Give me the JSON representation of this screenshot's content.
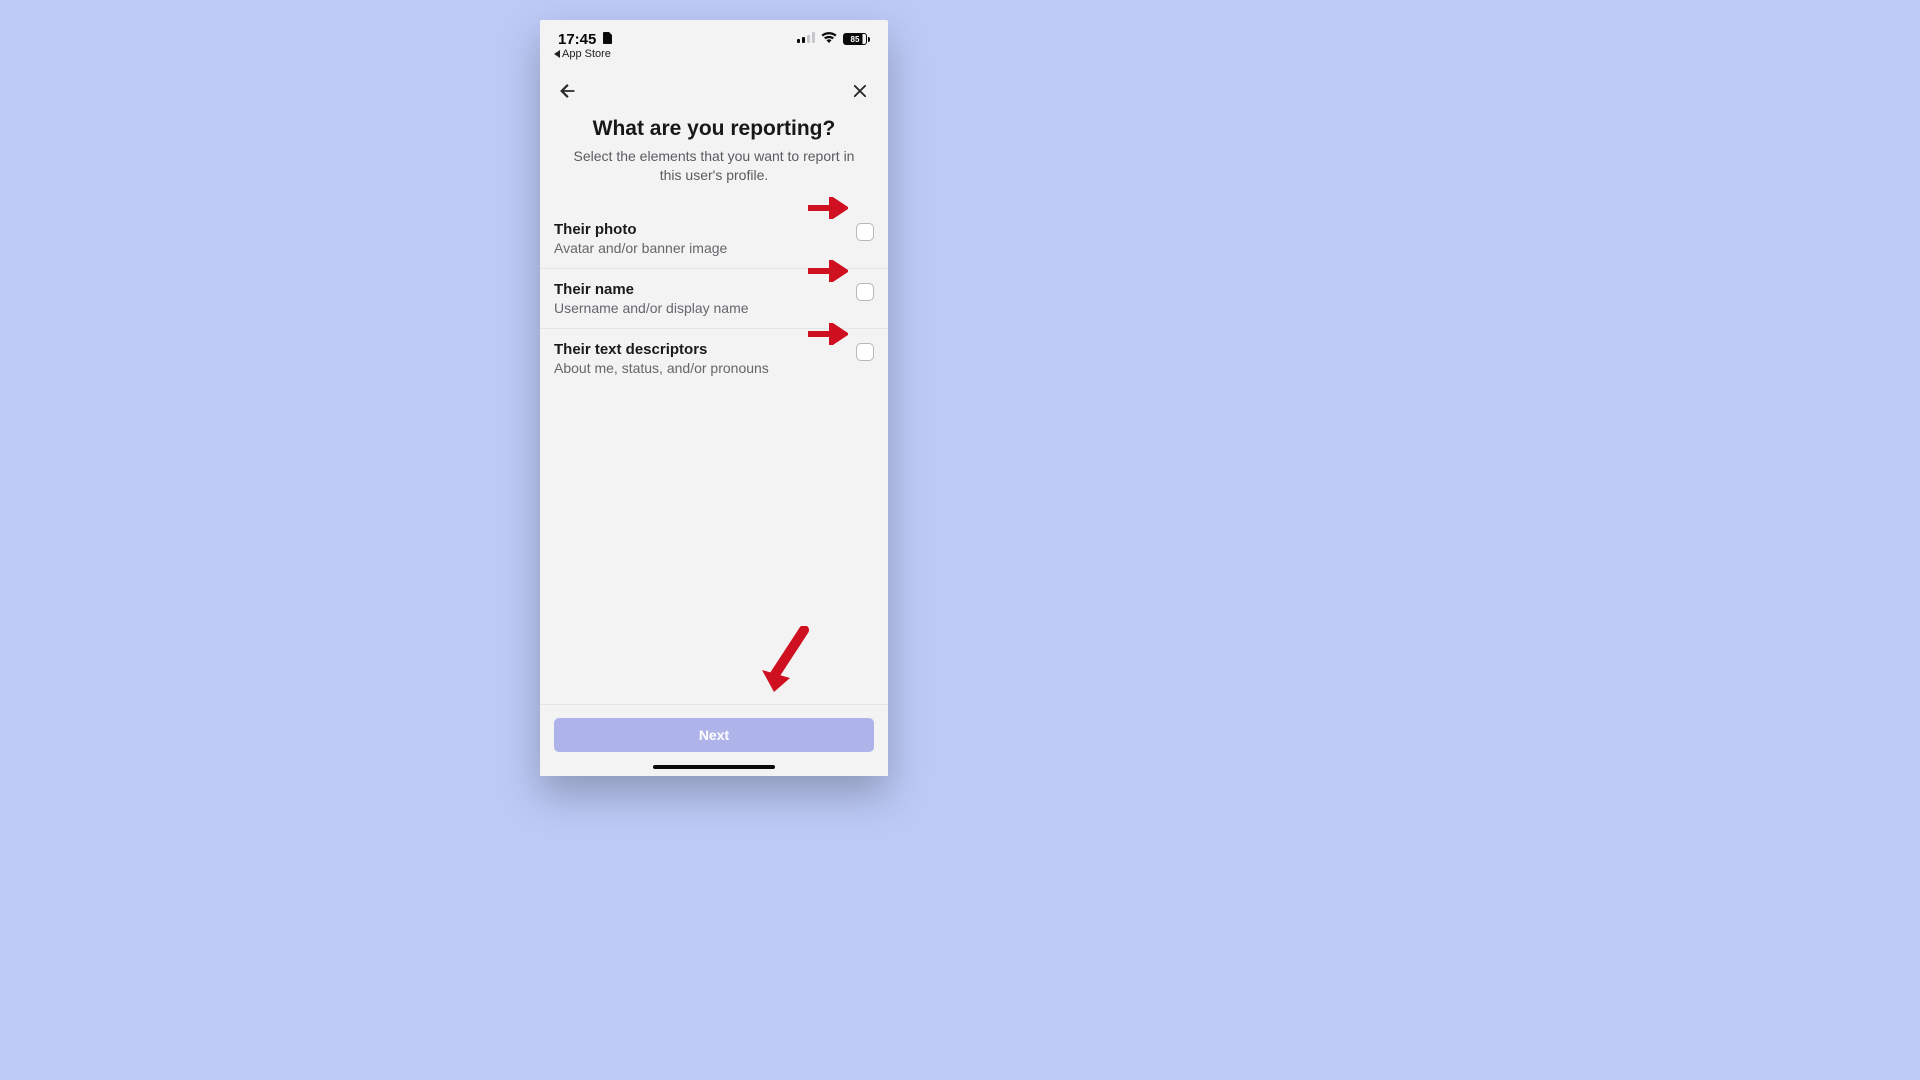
{
  "status": {
    "time": "17:45",
    "back_link": "App Store",
    "battery": "85"
  },
  "header": {
    "title": "What are you reporting?",
    "subtitle": "Select the elements that you want to report in this user's profile."
  },
  "options": [
    {
      "title": "Their photo",
      "desc": "Avatar and/or banner image"
    },
    {
      "title": "Their name",
      "desc": "Username and/or display name"
    },
    {
      "title": "Their text descriptors",
      "desc": "About me, status, and/or pronouns"
    }
  ],
  "footer": {
    "next_label": "Next"
  },
  "annotation": {
    "arrow_color": "#cf1020"
  }
}
